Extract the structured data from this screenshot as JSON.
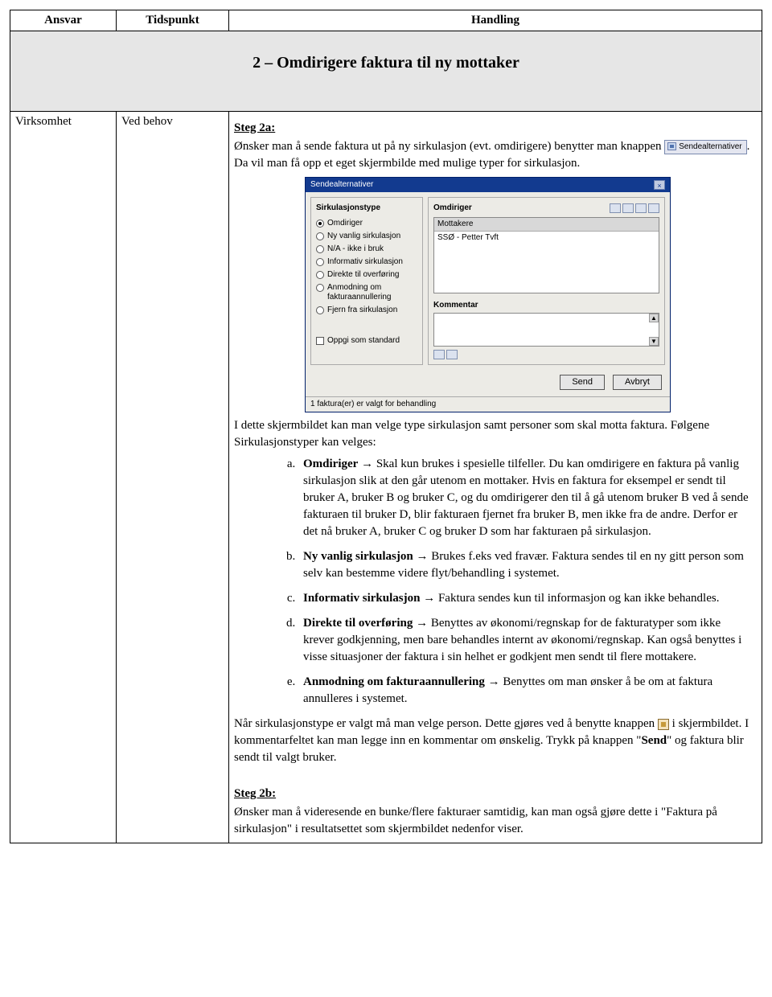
{
  "headers": {
    "ansvar": "Ansvar",
    "tidspunkt": "Tidspunkt",
    "handling": "Handling"
  },
  "section_title": "2 – Omdirigere faktura til ny mottaker",
  "row": {
    "ansvar": "Virksomhet",
    "tidspunkt": "Ved behov"
  },
  "step2a": {
    "title": "Steg 2a:",
    "line1_a": "Ønsker man å sende faktura ut på ny sirkulasjon (evt. omdirigere) benytter man knappen ",
    "button_label": "Sendealternativer",
    "line1_b": ". Da vil man få opp et eget skjermbilde med mulige typer for sirkulasjon.",
    "after_img": "I dette skjermbildet kan man velge type sirkulasjon samt personer som skal motta faktura. Følgene Sirkulasjonstyper kan velges:"
  },
  "dialog": {
    "title": "Sendealternativer",
    "left_title": "Sirkulasjonstype",
    "radios": [
      "Omdiriger",
      "Ny vanlig sirkulasjon",
      "N/A - ikke i bruk",
      "Informativ sirkulasjon",
      "Direkte til overføring",
      "Anmodning om fakturaannullering",
      "Fjern fra sirkulasjon"
    ],
    "checkbox": "Oppgi som standard",
    "right_title": "Omdiriger",
    "recipients_header": "Mottakere",
    "recipient_row": "SSØ - Petter Tvft",
    "comment_label": "Kommentar",
    "send": "Send",
    "cancel": "Avbryt",
    "status": "1 faktura(er) er valgt for behandling"
  },
  "options": {
    "a_label": "Omdiriger",
    "a_text": " Skal kun brukes i spesielle tilfeller. Du kan omdirigere en faktura på vanlig sirkulasjon slik at den går utenom en mottaker. Hvis en faktura for eksempel er sendt til bruker A, bruker B og bruker C, og du omdirigerer den til å gå utenom bruker B ved å sende fakturaen til bruker D, blir fakturaen fjernet fra bruker B, men ikke fra de andre. Derfor er det nå bruker A, bruker C og bruker D som har fakturaen på sirkulasjon.",
    "b_label": "Ny vanlig sirkulasjon",
    "b_text": " Brukes f.eks ved fravær. Faktura sendes til en ny gitt person som selv kan bestemme videre flyt/behandling i systemet.",
    "c_label": "Informativ sirkulasjon",
    "c_text": " Faktura sendes kun til informasjon og kan ikke behandles.",
    "d_label": "Direkte til overføring",
    "d_text": " Benyttes av økonomi/regnskap for de fakturatyper som ikke krever godkjenning, men bare behandles internt av økonomi/regnskap. Kan også benyttes i visse situasjoner der faktura i sin helhet er godkjent men sendt til flere mottakere.",
    "e_label": "Anmodning om fakturaannullering",
    "e_text": " Benyttes om man ønsker å be om at faktura annulleres i systemet."
  },
  "arrow": "→",
  "after_options": {
    "p1_a": "Når sirkulasjonstype er valgt må man velge person. Dette gjøres ved å benytte knappen ",
    "p1_b": " i skjermbildet. I kommentarfeltet kan man legge inn en kommentar om ønskelig. Trykk på knappen \"",
    "send_bold": "Send",
    "p1_c": "\" og faktura blir sendt til valgt bruker."
  },
  "step2b": {
    "title": "Steg 2b:",
    "text": "Ønsker man å videresende en bunke/flere fakturaer samtidig, kan man også gjøre dette i \"Faktura på sirkulasjon\" i resultatsettet som skjermbildet nedenfor viser."
  }
}
